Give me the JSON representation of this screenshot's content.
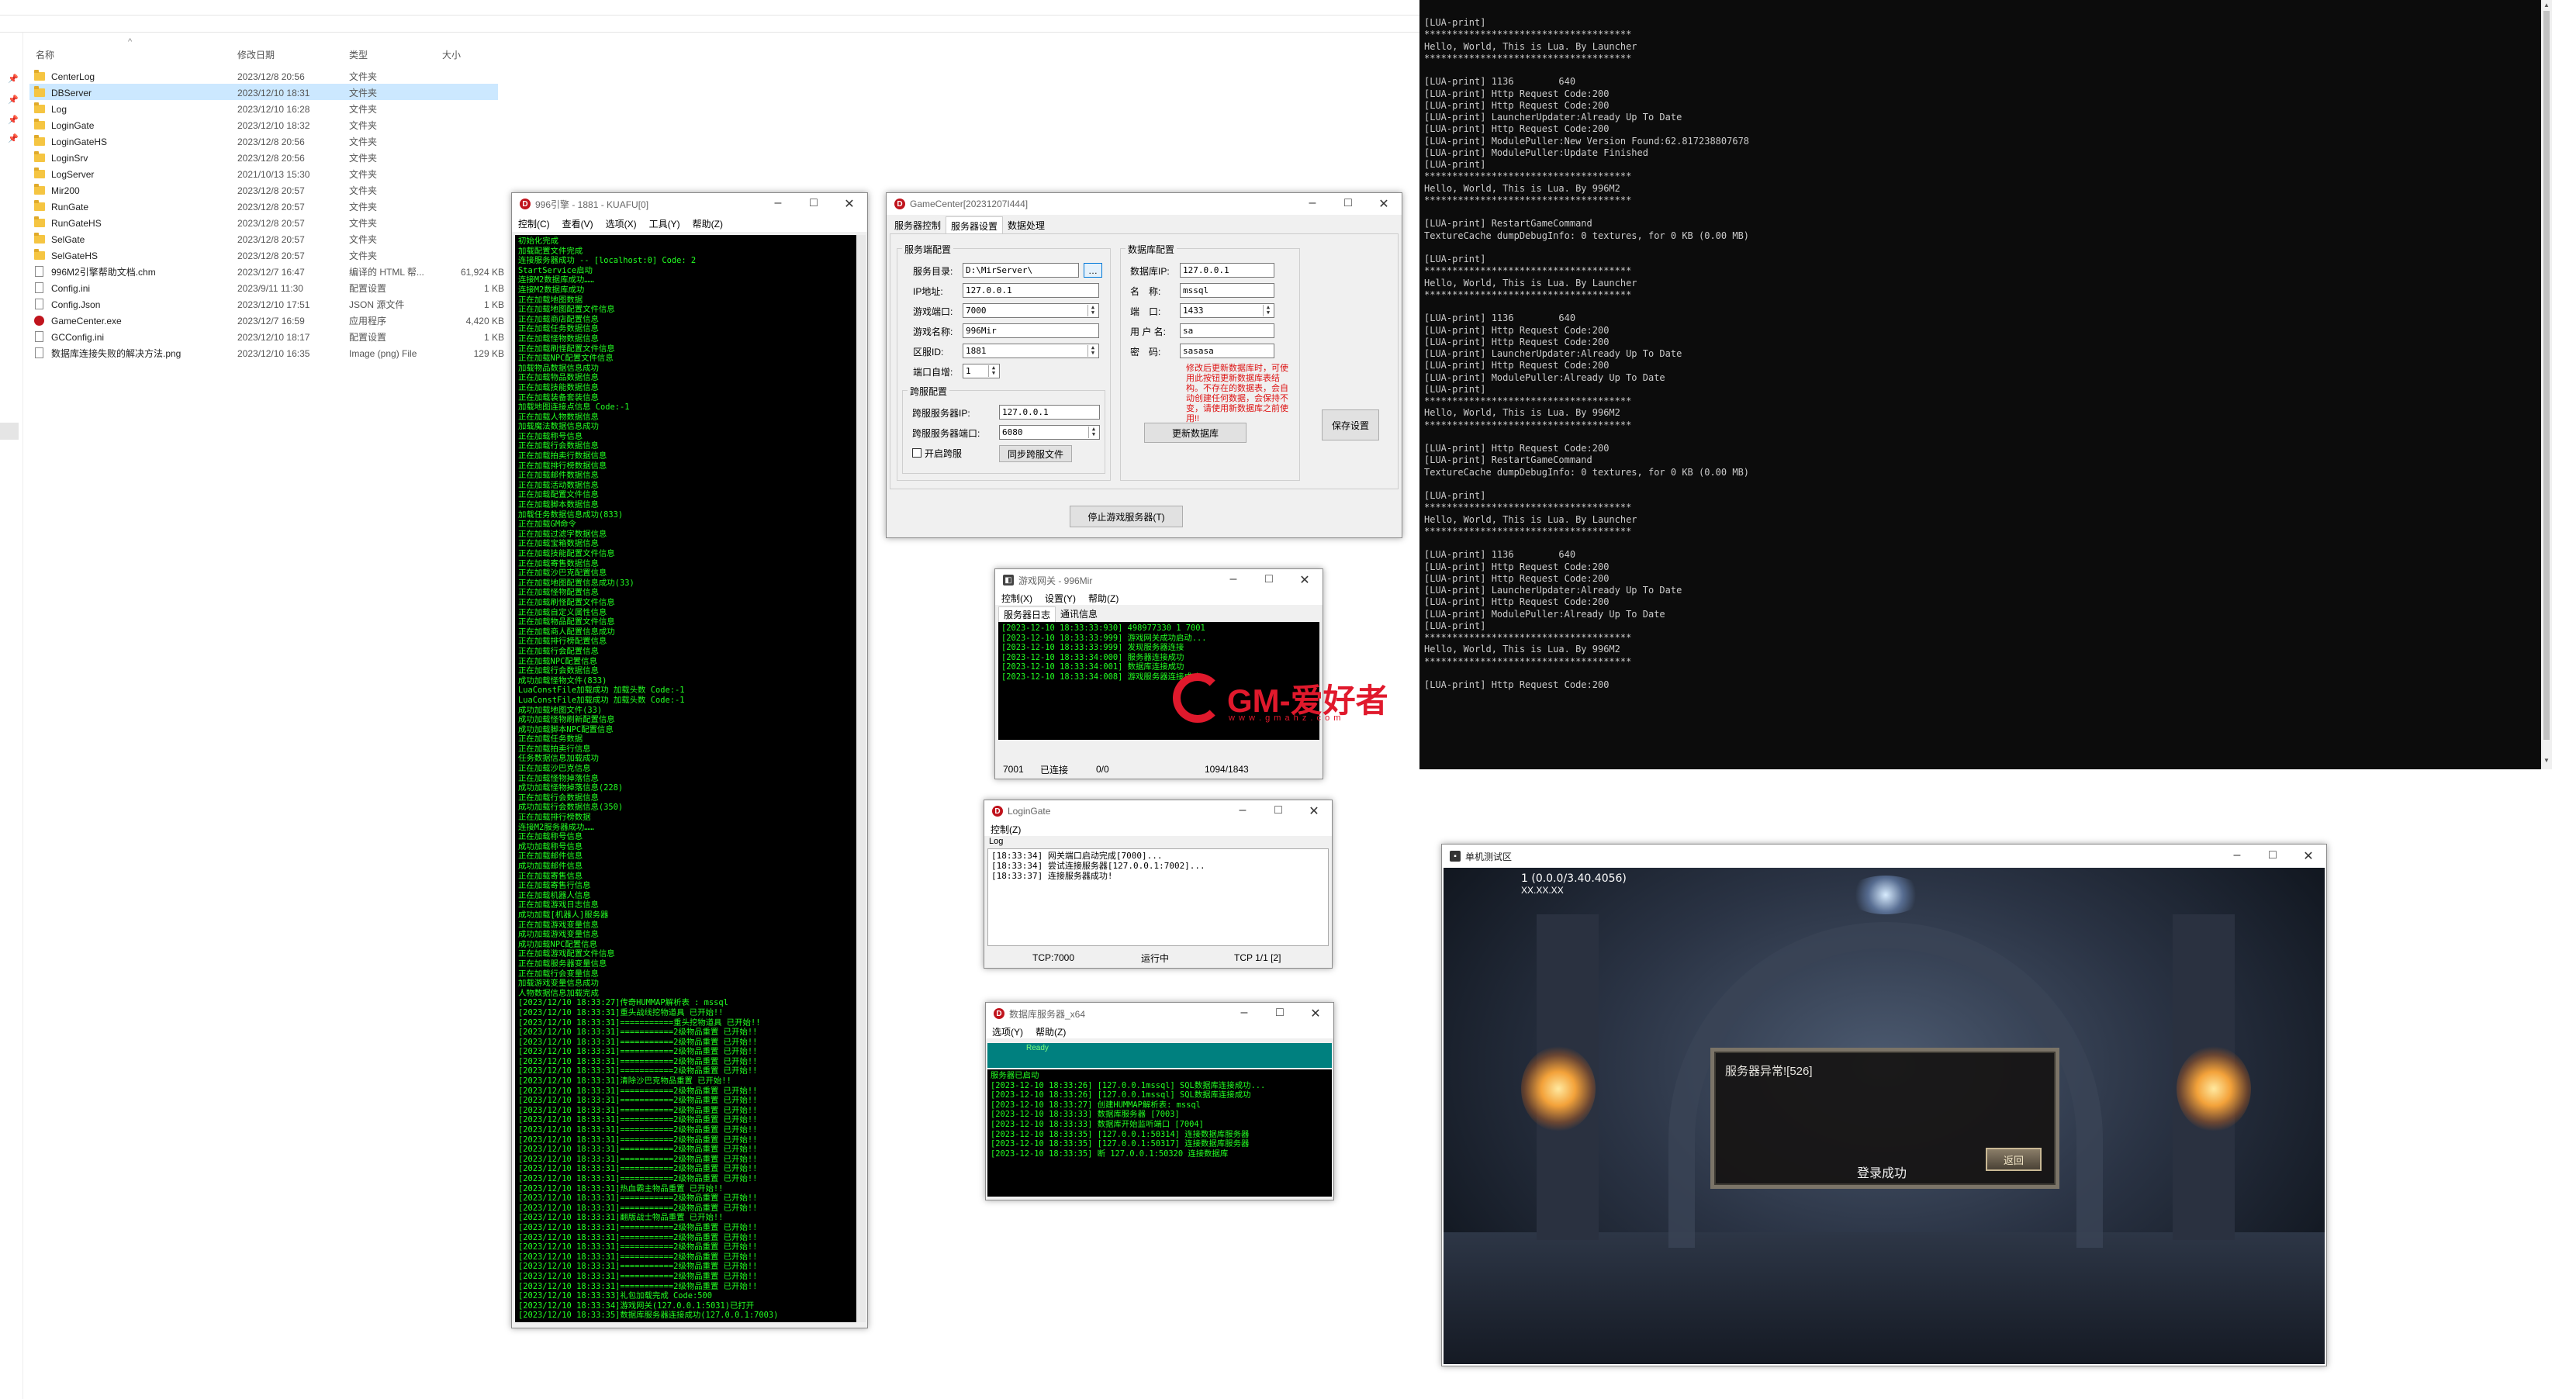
{
  "explorer": {
    "columns": {
      "name": "名称",
      "date": "修改日期",
      "type": "类型",
      "size": "大小"
    },
    "files": [
      {
        "name": "CenterLog",
        "date": "2023/12/8 20:56",
        "type": "文件夹",
        "size": "",
        "icon": "folder-icon"
      },
      {
        "name": "DBServer",
        "date": "2023/12/10 18:31",
        "type": "文件夹",
        "size": "",
        "icon": "folder-icon"
      },
      {
        "name": "Log",
        "date": "2023/12/10 16:28",
        "type": "文件夹",
        "size": "",
        "icon": "folder-icon"
      },
      {
        "name": "LoginGate",
        "date": "2023/12/10 18:32",
        "type": "文件夹",
        "size": "",
        "icon": "folder-icon"
      },
      {
        "name": "LoginGateHS",
        "date": "2023/12/8 20:56",
        "type": "文件夹",
        "size": "",
        "icon": "folder-icon"
      },
      {
        "name": "LoginSrv",
        "date": "2023/12/8 20:56",
        "type": "文件夹",
        "size": "",
        "icon": "folder-icon"
      },
      {
        "name": "LogServer",
        "date": "2021/10/13 15:30",
        "type": "文件夹",
        "size": "",
        "icon": "folder-icon"
      },
      {
        "name": "Mir200",
        "date": "2023/12/8 20:57",
        "type": "文件夹",
        "size": "",
        "icon": "folder-icon"
      },
      {
        "name": "RunGate",
        "date": "2023/12/8 20:57",
        "type": "文件夹",
        "size": "",
        "icon": "folder-icon"
      },
      {
        "name": "RunGateHS",
        "date": "2023/12/8 20:57",
        "type": "文件夹",
        "size": "",
        "icon": "folder-icon"
      },
      {
        "name": "SelGate",
        "date": "2023/12/8 20:57",
        "type": "文件夹",
        "size": "",
        "icon": "folder-icon"
      },
      {
        "name": "SelGateHS",
        "date": "2023/12/8 20:57",
        "type": "文件夹",
        "size": "",
        "icon": "folder-icon"
      },
      {
        "name": "996M2引擎帮助文档.chm",
        "date": "2023/12/7 16:47",
        "type": "编译的 HTML 帮...",
        "size": "61,924 KB",
        "icon": "file-icon"
      },
      {
        "name": "Config.ini",
        "date": "2023/9/11 11:30",
        "type": "配置设置",
        "size": "1 KB",
        "icon": "file-icon"
      },
      {
        "name": "Config.Json",
        "date": "2023/12/10 17:51",
        "type": "JSON 源文件",
        "size": "1 KB",
        "icon": "file-icon"
      },
      {
        "name": "GameCenter.exe",
        "date": "2023/12/7 16:59",
        "type": "应用程序",
        "size": "4,420 KB",
        "icon": "exe-icon"
      },
      {
        "name": "GCConfig.ini",
        "date": "2023/12/10 18:17",
        "type": "配置设置",
        "size": "1 KB",
        "icon": "file-icon"
      },
      {
        "name": "数据库连接失败的解决方法.png",
        "date": "2023/12/10 16:35",
        "type": "Image (png) File",
        "size": "129 KB",
        "icon": "file-icon"
      }
    ]
  },
  "m2": {
    "title": "996引擎 - 1881 - KUAFU[0]",
    "menu": [
      "控制(C)",
      "查看(V)",
      "选项(X)",
      "工具(Y)",
      "帮助(Z)"
    ],
    "log": "初始化完成\n加载配置文件完成\n连接服务器成功 -- [localhost:0] Code: 2\nStartService启动\n连接M2数据库成功……\n连接M2数据库成功\n正在加载地图数据\n正在加载地图配置文件信息\n正在加载商店配置信息\n正在加载任务数据信息\n正在加载怪物数据信息\n正在加载刷怪配置文件信息\n正在加载NPC配置文件信息\n加载物品数据信息成功\n正在加载物品数据信息\n正在加载技能数据信息\n正在加载装备套装信息\n加载地图连接点信息 Code:-1\n正在加载人物数据信息\n加载魔法数据信息成功\n正在加载称号信息\n正在加载行会数据信息\n正在加载拍卖行数据信息\n正在加载排行榜数据信息\n正在加载邮件数据信息\n正在加载活动数据信息\n正在加载配置文件信息\n正在加载脚本数据信息\n加载任务数据信息成功(833)\n正在加载GM命令\n正在加载过滤字数据信息\n正在加载宝箱数据信息\n正在加载技能配置文件信息\n正在加载寄售数据信息\n正在加载沙巴克配置信息\n正在加载地图配置信息成功(33)\n正在加载怪物配置信息\n正在加载刷怪配置文件信息\n正在加载自定义属性信息\n正在加载物品配置文件信息\n正在加载商人配置信息成功\n正在加载排行榜配置信息\n正在加载行会配置信息\n正在加载NPC配置信息\n正在加载行会数据信息\n成功加载怪物文件(833)\nLuaConstFile加载成功 加载头数 Code:-1\nLuaConstFile加载成功 加载头数 Code:-1\n成功加载地图文件(33)\n成功加载怪物刷新配置信息\n成功加载脚本NPC配置信息\n正在加载任务数据\n正在加载拍卖行信息\n任务数据信息加载成功\n正在加载沙巴克信息\n正在加载怪物掉落信息\n成功加载怪物掉落信息(228)\n正在加载行会数据信息\n成功加载行会数据信息(350)\n正在加载排行榜数据\n连接M2服务器成功……\n正在加载称号信息\n成功加载称号信息\n正在加载邮件信息\n成功加载邮件信息\n正在加载寄售信息\n正在加载寄售行信息\n正在加载机器人信息\n正在加载游戏日志信息\n成功加载[机器人]服务器\n正在加载游戏变量信息\n成功加载游戏变量信息\n成功加载NPC配置信息\n正在加载游戏配置文件信息\n正在加载服务器变量信息\n正在加载行会变量信息\n加载游戏变量信息成功\n人物数据信息加载完成\n[2023/12/10 18:33:27]传奇HUMMAP解析表 : mssql\n[2023/12/10 18:33:31]重头战线挖物道具 已开始!!\n[2023/12/10 18:33:31]===========重头挖物道具 已开始!!\n[2023/12/10 18:33:31]===========2级物品重置 已开始!!\n[2023/12/10 18:33:31]===========2级物品重置 已开始!!\n[2023/12/10 18:33:31]===========2级物品重置 已开始!!\n[2023/12/10 18:33:31]===========2级物品重置 已开始!!\n[2023/12/10 18:33:31]===========2级物品重置 已开始!!\n[2023/12/10 18:33:31]清除沙巴克物品重置 已开始!!\n[2023/12/10 18:33:31]===========2级物品重置 已开始!!\n[2023/12/10 18:33:31]===========2级物品重置 已开始!!\n[2023/12/10 18:33:31]===========2级物品重置 已开始!!\n[2023/12/10 18:33:31]===========2级物品重置 已开始!!\n[2023/12/10 18:33:31]===========2级物品重置 已开始!!\n[2023/12/10 18:33:31]===========2级物品重置 已开始!!\n[2023/12/10 18:33:31]===========2级物品重置 已开始!!\n[2023/12/10 18:33:31]===========2级物品重置 已开始!!\n[2023/12/10 18:33:31]===========2级物品重置 已开始!!\n[2023/12/10 18:33:31]===========2级物品重置 已开始!!\n[2023/12/10 18:33:31]热血霸主物品重置 已开始!!\n[2023/12/10 18:33:31]===========2级物品重置 已开始!!\n[2023/12/10 18:33:31]===========2级物品重置 已开始!!\n[2023/12/10 18:33:31]翻版战士物品重置 已开始!!\n[2023/12/10 18:33:31]===========2级物品重置 已开始!!\n[2023/12/10 18:33:31]===========2级物品重置 已开始!!\n[2023/12/10 18:33:31]===========2级物品重置 已开始!!\n[2023/12/10 18:33:31]===========2级物品重置 已开始!!\n[2023/12/10 18:33:31]===========2级物品重置 已开始!!\n[2023/12/10 18:33:31]===========2级物品重置 已开始!!\n[2023/12/10 18:33:31]===========2级物品重置 已开始!!\n[2023/12/10 18:33:33]礼包加载完成 Code:500\n[2023/12/10 18:33:34]游戏网关(127.0.0.1:5031)已打开\n[2023/12/10 18:33:35]数据库服务器连接成功(127.0.0.1:7003)"
  },
  "gamecenter": {
    "title": "GameCenter[20231207I444]",
    "tabs": [
      "服务器控制",
      "服务器设置",
      "数据处理"
    ],
    "server_group": "服务端配置",
    "root_label": "服务目录:",
    "root_value": "D:\\MirServer\\",
    "ip_label": "IP地址:",
    "ip_value": "127.0.0.1",
    "port_label": "游戏端口:",
    "port_value": "7000",
    "name_label": "游戏名称:",
    "name_value": "996Mir",
    "zone_label": "区服ID:",
    "zone_value": "1881",
    "portinc_label": "端口自增:",
    "portinc_value": "1",
    "cross_group": "跨服配置",
    "cross_ip_label": "跨服服务器IP:",
    "cross_ip_value": "127.0.0.1",
    "cross_port_label": "跨服服务器端口:",
    "cross_port_value": "6080",
    "cross_check_label": "开启跨服",
    "cross_sync_button": "同步跨服文件",
    "db_group": "数据库配置",
    "db_ip_label": "数据库IP:",
    "db_ip_value": "127.0.0.1",
    "db_name_label": "名　称:",
    "db_name_value": "mssql",
    "db_port_label": "端　口:",
    "db_port_value": "1433",
    "db_user_label": "用 户 名:",
    "db_user_value": "sa",
    "db_pass_label": "密　码:",
    "db_pass_value": "sasasa",
    "warning": "修改后更新数据库时，可使用此按钮更新数据库表结构。不存在的数据表，会自动创建任何数据，会保持不变，请使用新数据库之前使用!!",
    "update_db_button": "更新数据库",
    "save_button": "保存设置",
    "stop_button": "停止游戏服务器(T)"
  },
  "rungate": {
    "title": "游戏网关 - 996Mir",
    "menu": [
      "控制(X)",
      "设置(Y)",
      "帮助(Z)"
    ],
    "tabs": [
      "服务器日志",
      "通讯信息"
    ],
    "log": "[2023-12-10 18:33:33:930] 498977330 1 7001\n[2023-12-10 18:33:33:999] 游戏网关成功启动...\n[2023-12-10 18:33:33:999] 发现服务器连接\n[2023-12-10 18:33:34:000] 服务器连接成功\n[2023-12-10 18:33:34:001] 数据库连接成功\n[2023-12-10 18:33:34:008] 游戏服务器连接成功",
    "status": [
      "7001",
      "已连接",
      "0/0",
      "1094/1843"
    ]
  },
  "logingate": {
    "title": "LoginGate",
    "menu": [
      "控制(Z)"
    ],
    "tab": "Log",
    "log": "[18:33:34] 网关端口启动完成[7000]...\n[18:33:34] 尝试连接服务器[127.0.0.1:7002]...\n[18:33:37] 连接服务器成功!",
    "status": [
      "TCP:7000",
      "运行中",
      "TCP 1/1 [2]"
    ]
  },
  "dbserver": {
    "title": "数据库服务器_x64",
    "menu": [
      "选项(Y)",
      "帮助(Z)"
    ],
    "band": "Ready",
    "log": "服务器已启动\n[2023-12-10 18:33:26] [127.0.0.1mssql] SQL数据库连接成功...\n[2023-12-10 18:33:26] [127.0.0.1mssql] SQL数据库连接成功\n[2023-12-10 18:33:27] 创建HUMMAP解析表: mssql\n[2023-12-10 18:33:33] 数据库服务器 [7003]\n[2023-12-10 18:33:33] 数据库开始监听端口 [7004]\n[2023-12-10 18:33:35] [127.0.0.1:50314] 连接数据库服务器\n[2023-12-10 18:33:35] [127.0.0.1:50317] 连接数据库服务器\n[2023-12-10 18:33:35] 断 127.0.0.1:50320 连接数据库"
  },
  "lua_console": {
    "text": "[LUA-print]\n*************************************\nHello, World, This is Lua. By Launcher\n*************************************\n\n[LUA-print] 1136        640\n[LUA-print] Http Request Code:200\n[LUA-print] Http Request Code:200\n[LUA-print] LauncherUpdater:Already Up To Date\n[LUA-print] Http Request Code:200\n[LUA-print] ModulePuller:New Version Found:62.817238807678\n[LUA-print] ModulePuller:Update Finished\n[LUA-print]\n*************************************\nHello, World, This is Lua. By 996M2\n*************************************\n\n[LUA-print] RestartGameCommand\nTextureCache dumpDebugInfo: 0 textures, for 0 KB (0.00 MB)\n\n[LUA-print]\n*************************************\nHello, World, This is Lua. By Launcher\n*************************************\n\n[LUA-print] 1136        640\n[LUA-print] Http Request Code:200\n[LUA-print] Http Request Code:200\n[LUA-print] LauncherUpdater:Already Up To Date\n[LUA-print] Http Request Code:200\n[LUA-print] ModulePuller:Already Up To Date\n[LUA-print]\n*************************************\nHello, World, This is Lua. By 996M2\n*************************************\n\n[LUA-print] Http Request Code:200\n[LUA-print] RestartGameCommand\nTextureCache dumpDebugInfo: 0 textures, for 0 KB (0.00 MB)\n\n[LUA-print]\n*************************************\nHello, World, This is Lua. By Launcher\n*************************************\n\n[LUA-print] 1136        640\n[LUA-print] Http Request Code:200\n[LUA-print] Http Request Code:200\n[LUA-print] LauncherUpdater:Already Up To Date\n[LUA-print] Http Request Code:200\n[LUA-print] ModulePuller:Already Up To Date\n[LUA-print]\n*************************************\nHello, World, This is Lua. By 996M2\n*************************************\n\n[LUA-print] Http Request Code:200"
  },
  "game": {
    "title": "单机测试区",
    "version": "1 (0.0.0/3.40.4056)",
    "sub": "XX.XX.XX",
    "dialog_msg": "服务器异常![526]",
    "login_ok": "登录成功",
    "back_button": "返回"
  },
  "watermark": {
    "main": "GM-爱好者",
    "sub": "w w w . g m a h z . c o m"
  },
  "colors": {
    "terminal_green": "#22ff22",
    "teal_band": "#00807f",
    "accent_red": "#c0141d"
  }
}
